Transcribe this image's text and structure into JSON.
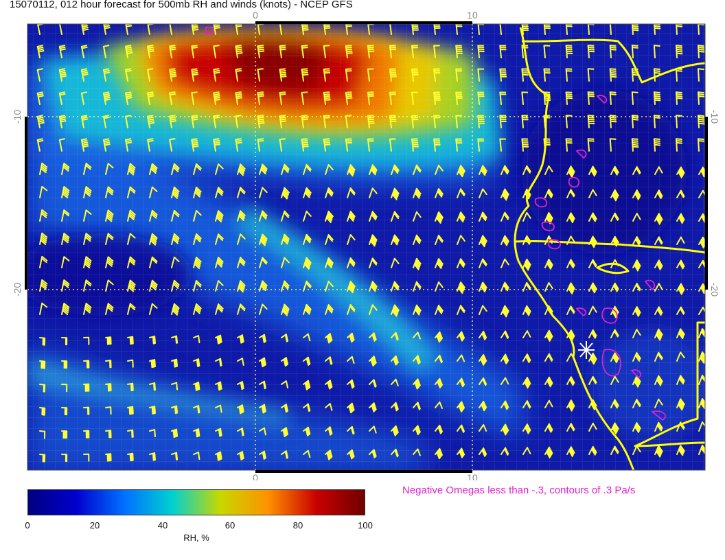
{
  "title": "15070112, 012 hour forecast for 500mb RH and winds (knots) - NCEP GFS",
  "map": {
    "lon_ticks": [
      "0",
      "10"
    ],
    "lat_ticks": [
      "-10",
      "-20"
    ]
  },
  "omega_note": "Negative Omegas less than -.3, contours of .3 Pa/s",
  "colorbar": {
    "title": "RH, %",
    "labels": [
      "0",
      "20",
      "40",
      "60",
      "80",
      "100"
    ],
    "colors": [
      "#000080",
      "#0000cd",
      "#0070ff",
      "#00d0d0",
      "#c8d800",
      "#ff9000",
      "#c80000",
      "#700000"
    ]
  },
  "colors": {
    "barbs": "#ffff33",
    "coastline": "#ffff00",
    "omega_contours": "#e020d0",
    "grid_lines": "#ffff88"
  },
  "icons": {
    "station_marker": "white-asterisk"
  }
}
